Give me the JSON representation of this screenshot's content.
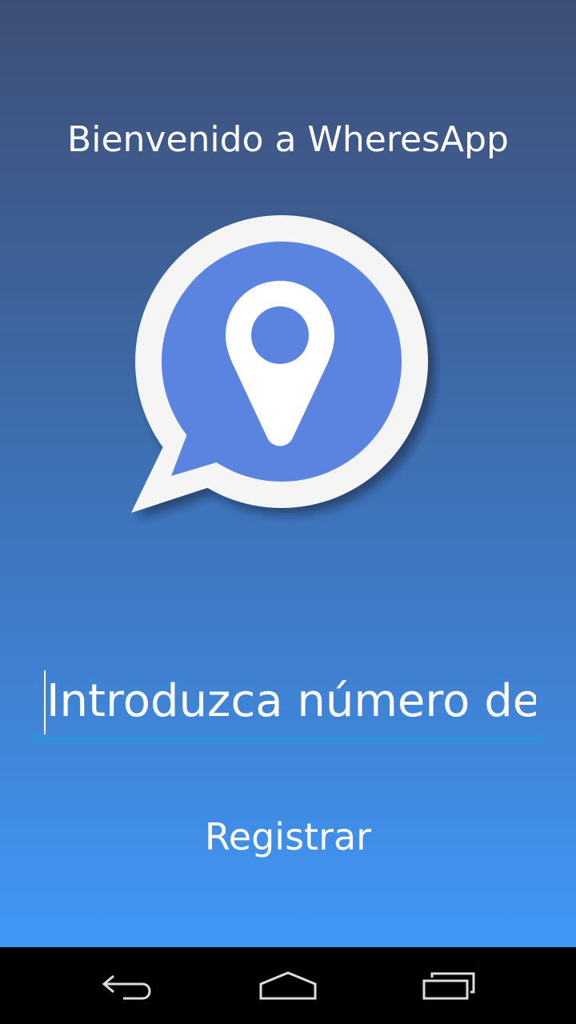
{
  "app": {
    "welcome_title": "Bienvenido a WheresApp",
    "logo_icon": "map-pin-chat-bubble-icon"
  },
  "form": {
    "phone_placeholder": "Introduzca número de teléfono",
    "phone_value": "",
    "register_label": "Registrar"
  },
  "navbar": {
    "back_icon": "back-arrow-icon",
    "home_icon": "home-icon",
    "recents_icon": "recent-apps-icon"
  },
  "colors": {
    "gradient_top": "#3e4f77",
    "gradient_bottom": "#4197f7",
    "logo_fill": "#5b84e1",
    "input_underline": "#1e9ad6",
    "text": "#ffffff"
  }
}
